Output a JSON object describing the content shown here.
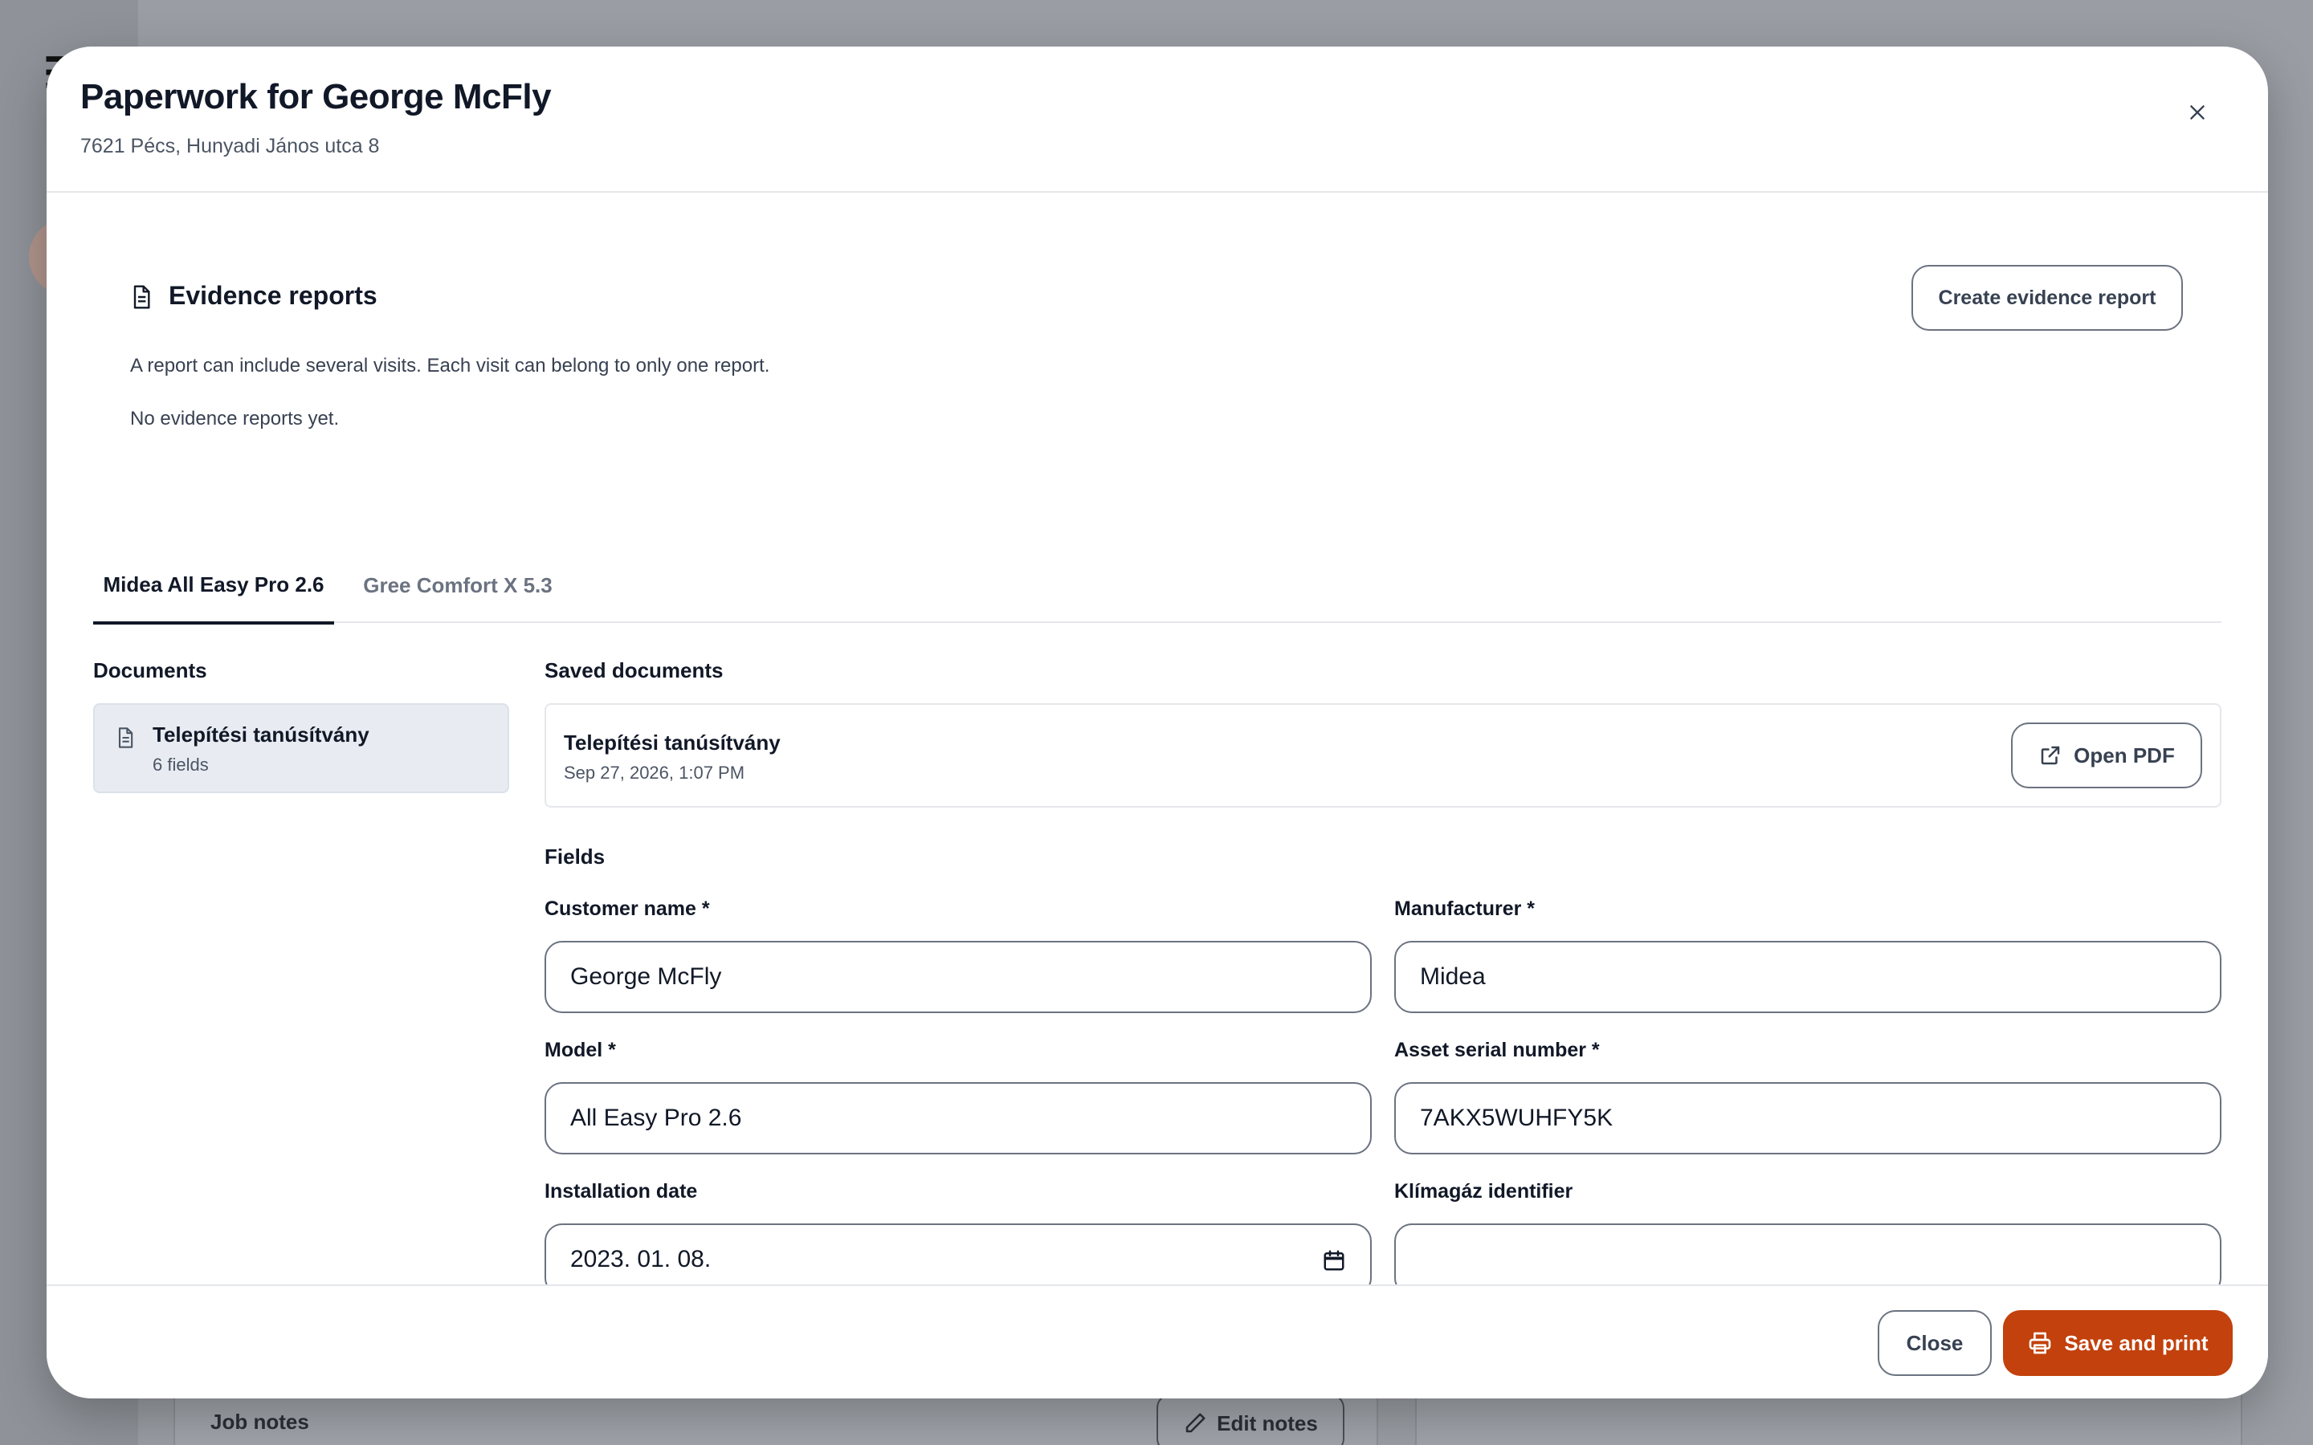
{
  "background": {
    "job_notes_label": "Job notes",
    "edit_notes_label": "Edit notes"
  },
  "modal": {
    "title": "Paperwork for George McFly",
    "subtitle": "7621 Pécs, Hunyadi János utca 8"
  },
  "evidence": {
    "title": "Evidence reports",
    "create_button": "Create evidence report",
    "description": "A report can include several visits. Each visit can belong to only one report.",
    "empty_text": "No evidence reports yet."
  },
  "tabs": [
    {
      "label": "Midea All Easy Pro 2.6",
      "active": true
    },
    {
      "label": "Gree Comfort X 5.3",
      "active": false
    }
  ],
  "documents": {
    "heading": "Documents",
    "items": [
      {
        "title": "Telepítési tanúsítvány",
        "subtitle": "6 fields"
      }
    ]
  },
  "saved_documents": {
    "heading": "Saved documents",
    "items": [
      {
        "title": "Telepítési tanúsítvány",
        "date": "Sep 27, 2026, 1:07 PM",
        "open_label": "Open PDF"
      }
    ]
  },
  "fields": {
    "heading": "Fields",
    "customer_name": {
      "label": "Customer name *",
      "value": "George McFly"
    },
    "manufacturer": {
      "label": "Manufacturer *",
      "value": "Midea"
    },
    "model": {
      "label": "Model *",
      "value": "All Easy Pro 2.6"
    },
    "asset_serial": {
      "label": "Asset serial number *",
      "value": "7AKX5WUHFY5K"
    },
    "installation_date": {
      "label": "Installation date",
      "value": "2023. 01. 08."
    },
    "klimagaz": {
      "label": "Klímagáz identifier",
      "value": ""
    }
  },
  "footer": {
    "close_label": "Close",
    "save_label": "Save and print"
  },
  "colors": {
    "accent": "#c2410c",
    "active_doc_bg": "#e8ecf2"
  }
}
